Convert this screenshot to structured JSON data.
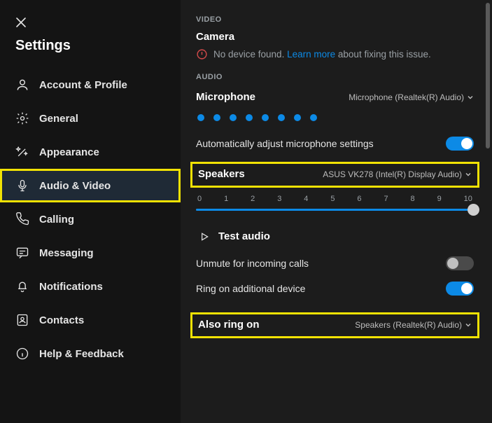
{
  "title": "Settings",
  "sidebar": {
    "items": [
      {
        "label": "Account & Profile"
      },
      {
        "label": "General"
      },
      {
        "label": "Appearance"
      },
      {
        "label": "Audio & Video"
      },
      {
        "label": "Calling"
      },
      {
        "label": "Messaging"
      },
      {
        "label": "Notifications"
      },
      {
        "label": "Contacts"
      },
      {
        "label": "Help & Feedback"
      }
    ]
  },
  "video": {
    "section": "VIDEO",
    "heading": "Camera",
    "warning": "No device found.",
    "learn_more": "Learn more",
    "warning_suffix": "about fixing this issue."
  },
  "audio": {
    "section": "AUDIO",
    "mic": {
      "heading": "Microphone",
      "device": "Microphone (Realtek(R) Audio)"
    },
    "auto_adjust": "Automatically adjust microphone settings",
    "speakers": {
      "heading": "Speakers",
      "device": "ASUS VK278 (Intel(R) Display Audio)"
    },
    "slider": {
      "min": 0,
      "max": 10,
      "value": 10
    },
    "test_audio": "Test audio",
    "unmute": "Unmute for incoming calls",
    "ring_additional": "Ring on additional device",
    "also_ring": {
      "heading": "Also ring on",
      "device": "Speakers (Realtek(R) Audio)"
    }
  }
}
